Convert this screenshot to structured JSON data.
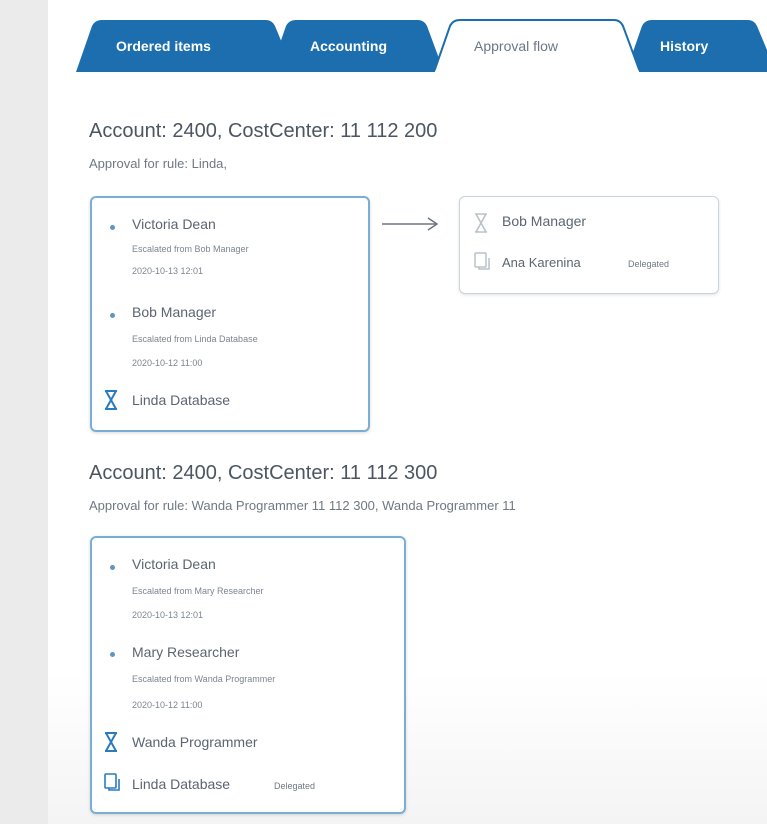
{
  "tabs": [
    {
      "label": "Ordered items",
      "active": false
    },
    {
      "label": "Accounting",
      "active": false
    },
    {
      "label": "Approval flow",
      "active": true
    },
    {
      "label": "History",
      "active": false
    }
  ],
  "colors": {
    "tab_blue": "#1c6eaf",
    "card_border": "#7aaed4",
    "text": "#5a6470"
  },
  "sections": [
    {
      "title": "Account: 2400, CostCenter: 11 112 200",
      "rule": "Approval for rule: Linda,",
      "card": {
        "entries": [
          {
            "name": "Victoria Dean",
            "detail": "Escalated from Bob Manager",
            "date": "2020-10-13 12:01",
            "icon": "bullet-dot-icon"
          },
          {
            "name": "Bob Manager",
            "detail": "Escalated from Linda Database",
            "date": "2020-10-12 11:00",
            "icon": "bullet-dot-icon"
          },
          {
            "name": "Linda Database",
            "icon": "hourglass-icon"
          }
        ]
      },
      "next_card": {
        "entries": [
          {
            "name": "Bob Manager",
            "icon": "hourglass-icon"
          },
          {
            "name": "Ana Karenina",
            "badge": "Delegated",
            "icon": "delegate-icon"
          }
        ]
      }
    },
    {
      "title": "Account: 2400, CostCenter: 11 112 300",
      "rule": "Approval for rule: Wanda Programmer 11 112 300, Wanda Programmer 11",
      "card": {
        "entries": [
          {
            "name": "Victoria Dean",
            "detail": "Escalated from Mary Researcher",
            "date": "2020-10-13 12:01",
            "icon": "bullet-dot-icon"
          },
          {
            "name": "Mary Researcher",
            "detail": "Escalated from Wanda Programmer",
            "date": "2020-10-12 11:00",
            "icon": "bullet-dot-icon"
          },
          {
            "name": "Wanda Programmer",
            "icon": "hourglass-icon"
          },
          {
            "name": "Linda Database",
            "badge": "Delegated",
            "icon": "delegate-icon"
          }
        ]
      }
    }
  ]
}
